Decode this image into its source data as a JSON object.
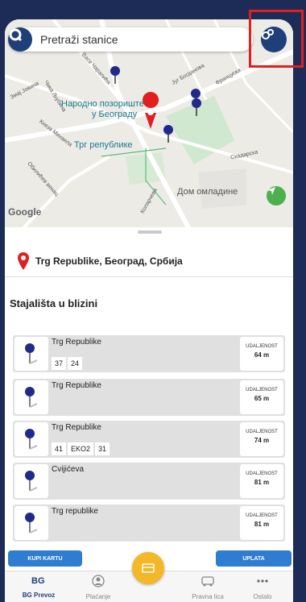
{
  "search": {
    "placeholder": "Pretraži stanice"
  },
  "map": {
    "labels": {
      "theatre": "Народно позориште",
      "theatre2": "у Београду",
      "square": "Трг републике",
      "youth": "Дом омладине",
      "google": "Google"
    },
    "streets": {
      "s1": "Васе Чарапића",
      "s2": "Змај Јовина",
      "s3": "Чика Љубина",
      "s4": "Кнеза Михаила",
      "s5": "Обилићев венац",
      "s6": "Југ Богданова",
      "s7": "Француска",
      "s8": "Скадарска",
      "s9": "Коларчева"
    }
  },
  "location": {
    "name": "Trg Republike, Београд, Србија"
  },
  "nearby": {
    "title": "Stajališta u blizini",
    "distance_label": "UDALJENOST",
    "stations": [
      {
        "name": "Trg Republike",
        "lines": [
          "37",
          "24"
        ],
        "distance": "64 m"
      },
      {
        "name": "Trg Republike",
        "lines": [],
        "distance": "65 m"
      },
      {
        "name": "Trg Republike",
        "lines": [
          "41",
          "EKO2",
          "31"
        ],
        "distance": "74 m"
      },
      {
        "name": "Cvijićeva",
        "lines": [],
        "distance": "81 m"
      },
      {
        "name": "Trg republike",
        "lines": [],
        "distance": "81 m"
      }
    ]
  },
  "actions": {
    "buy": "KUPI KARTU",
    "pay": "UPLATA"
  },
  "nav": {
    "home": "BG Prevoz",
    "payment": "Plaćanje",
    "legal": "Pravna lica",
    "more": "Ostalo"
  },
  "colors": {
    "brand": "#1f3f7a",
    "accent": "#f4b728",
    "button": "#2e7dd1",
    "pin": "#1f2a8a"
  }
}
